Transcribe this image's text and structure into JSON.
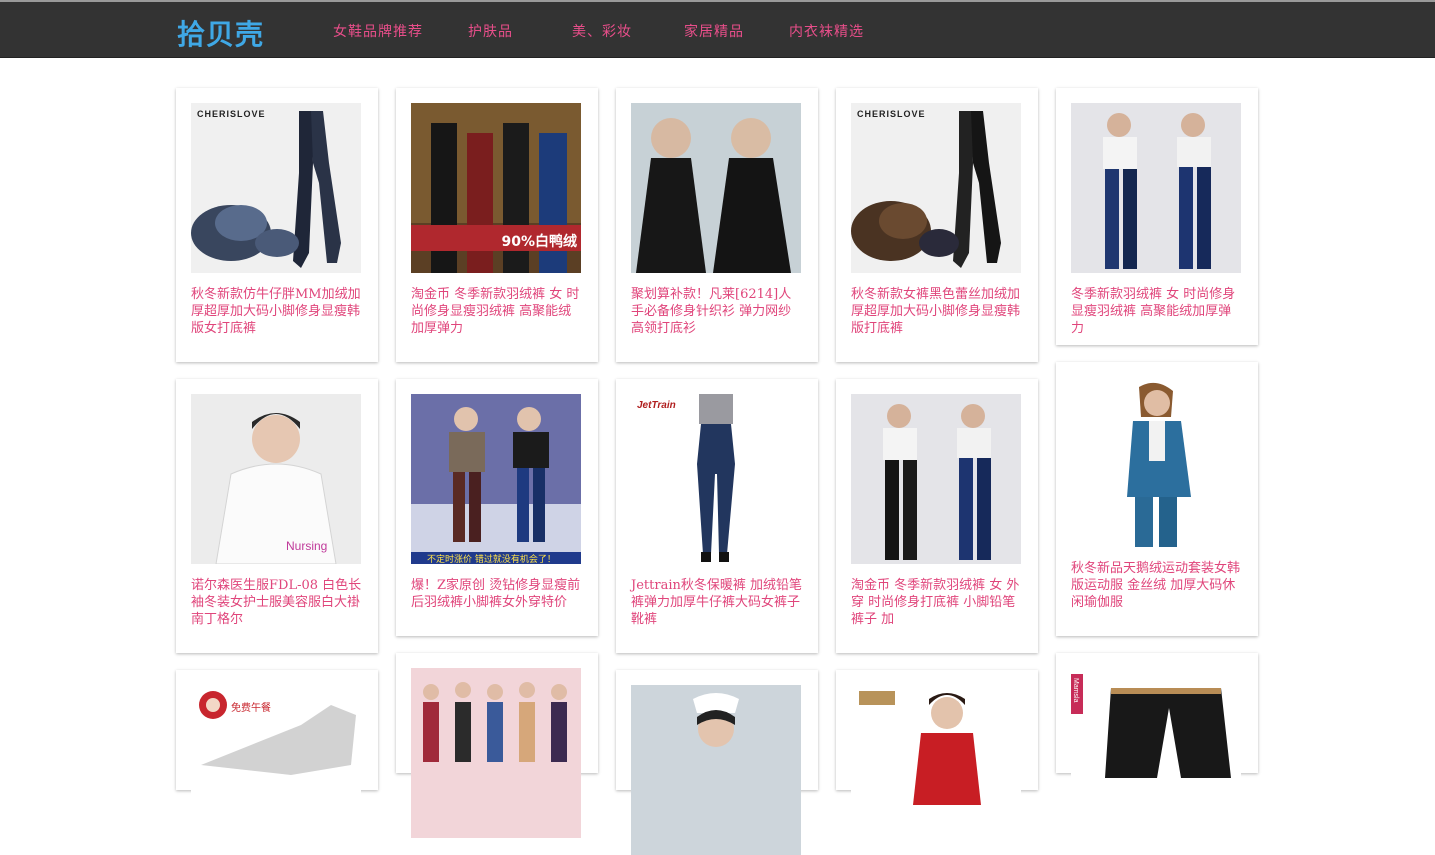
{
  "app": {
    "logo": "拾贝壳"
  },
  "nav": {
    "items": [
      {
        "label": "女鞋品牌推荐"
      },
      {
        "label": "护肤品"
      },
      {
        "label": "美、彩妆"
      },
      {
        "label": "家居精品"
      },
      {
        "label": "内衣袜精选"
      }
    ]
  },
  "products": [
    {
      "title": "秋冬新款仿牛仔胖MM加绒加厚超厚加大码小脚修身显瘦韩版女打底裤",
      "image_label": "CHERISLOVE",
      "image": "leggings-fleece"
    },
    {
      "title": "淘金币 冬季新款羽绒裤 女 时尚修身显瘦羽绒裤 高聚能绒加厚弹力",
      "image_label": "90%白鸭绒",
      "image": "down-pants-models"
    },
    {
      "title": "聚划算补款！凡莱[6214]人手必备修身针织衫 弹力网纱高领打底衫",
      "image_label": "",
      "image": "black-turtleneck"
    },
    {
      "title": "秋冬新款女裤黑色蕾丝加绒加厚超厚加大码小脚修身显瘦韩版打底裤",
      "image_label": "CHERISLOVE",
      "image": "leggings-brown-fleece"
    },
    {
      "title": "冬季新款羽绒裤 女 时尚修身显瘦羽绒裤 高聚能绒加厚弹力",
      "image_label": "",
      "image": "down-pants-blue"
    },
    {
      "title": "诺尔森医生服FDL-08 白色长袖冬装女护士服美容服白大褂南丁格尔",
      "image_label": "Nursing",
      "image": "nurse-white-coat"
    },
    {
      "title": "爆！Z家原创 烫钻修身显瘦前后羽绒裤小脚裤女外穿特价",
      "image_label": "不定时涨价 错过就没有机会了！",
      "image": "snow-down-pants"
    },
    {
      "title": "Jettrain秋冬保暖裤 加绒铅笔裤弹力加厚牛仔裤大码女裤子靴裤",
      "image_label": "JetTrain",
      "image": "jeans"
    },
    {
      "title": "淘金币 冬季新款羽绒裤 女 外穿 时尚修身打底裤 小脚铅笔裤子 加",
      "image_label": "",
      "image": "down-pants-blue-2"
    },
    {
      "title": "秋冬新品天鹅绒运动套装女韩版运动服 金丝绒 加厚大码休闲瑜伽服",
      "image_label": "",
      "image": "velvet-tracksuit"
    },
    {
      "title": "",
      "image_label": "免费午餐",
      "image": "map-logo"
    },
    {
      "title": "",
      "image_label": "",
      "image": "leggings-lineup"
    },
    {
      "title": "",
      "image_label": "",
      "image": "nurse-cap"
    },
    {
      "title": "",
      "image_label": "",
      "image": "red-coat"
    },
    {
      "title": "",
      "image_label": "Mamsla",
      "image": "black-trousers"
    }
  ],
  "colors": {
    "nav_bg": "#333333",
    "logo": "#3fa8e6",
    "link": "#e84e8a",
    "title": "#e0457b"
  }
}
